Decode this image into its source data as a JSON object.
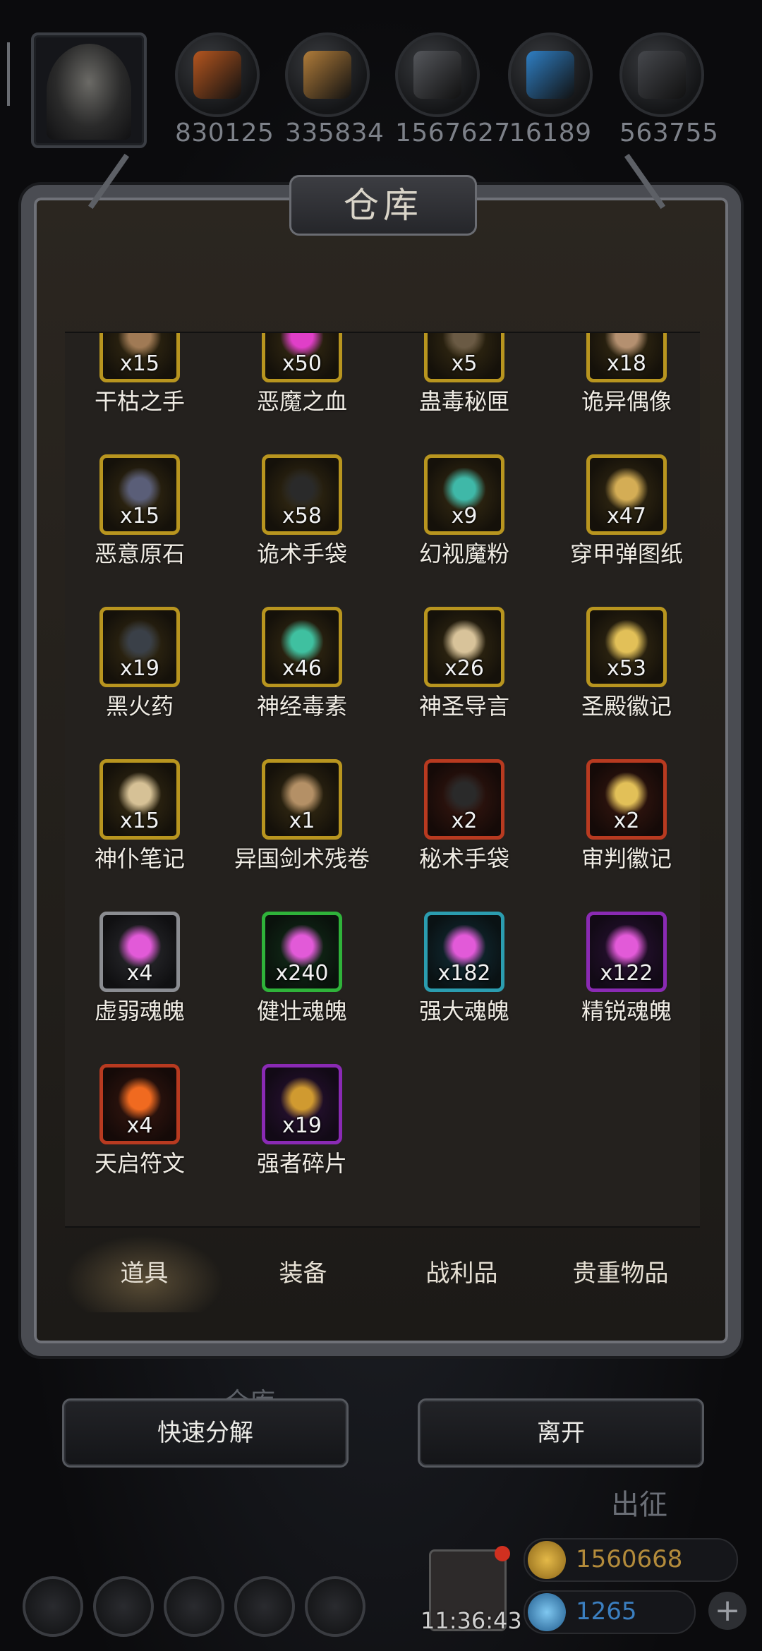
{
  "resources": [
    {
      "value": "830125",
      "icon": "meat-icon",
      "color": "#b5561f"
    },
    {
      "value": "335834",
      "icon": "wood-icon",
      "color": "#b07c3a"
    },
    {
      "value": "1567627",
      "icon": "iron-icon",
      "color": "#55575c"
    },
    {
      "value": "16189",
      "icon": "crystal-icon",
      "color": "#2f7fc4"
    },
    {
      "value": "563755",
      "icon": "ore-icon",
      "color": "#46484d"
    }
  ],
  "panel": {
    "title": "仓库"
  },
  "items": [
    {
      "name": "干枯之手",
      "qty": "x15",
      "rarity": "gold",
      "icon": "withered-hand-icon"
    },
    {
      "name": "恶魔之血",
      "qty": "x50",
      "rarity": "gold",
      "icon": "demon-blood-icon"
    },
    {
      "name": "蛊毒秘匣",
      "qty": "x5",
      "rarity": "gold",
      "icon": "poison-box-icon"
    },
    {
      "name": "诡异偶像",
      "qty": "x18",
      "rarity": "gold",
      "icon": "idol-icon"
    },
    {
      "name": "恶意原石",
      "qty": "x15",
      "rarity": "gold",
      "icon": "malice-stone-icon"
    },
    {
      "name": "诡术手袋",
      "qty": "x58",
      "rarity": "gold",
      "icon": "trick-bag-icon"
    },
    {
      "name": "幻视魔粉",
      "qty": "x9",
      "rarity": "gold",
      "icon": "magic-powder-icon"
    },
    {
      "name": "穿甲弹图纸",
      "qty": "x47",
      "rarity": "gold",
      "icon": "blueprint-icon"
    },
    {
      "name": "黑火药",
      "qty": "x19",
      "rarity": "gold",
      "icon": "black-powder-icon"
    },
    {
      "name": "神经毒素",
      "qty": "x46",
      "rarity": "gold",
      "icon": "neurotoxin-icon"
    },
    {
      "name": "神圣导言",
      "qty": "x26",
      "rarity": "gold",
      "icon": "holy-scroll-icon"
    },
    {
      "name": "圣殿徽记",
      "qty": "x53",
      "rarity": "gold",
      "icon": "temple-emblem-icon"
    },
    {
      "name": "神仆笔记",
      "qty": "x15",
      "rarity": "gold",
      "icon": "notes-icon"
    },
    {
      "name": "异国剑术残卷",
      "qty": "x1",
      "rarity": "gold",
      "icon": "sword-scroll-icon"
    },
    {
      "name": "秘术手袋",
      "qty": "x2",
      "rarity": "red",
      "icon": "arcane-bag-icon"
    },
    {
      "name": "审判徽记",
      "qty": "x2",
      "rarity": "red",
      "icon": "judgment-emblem-icon"
    },
    {
      "name": "虚弱魂魄",
      "qty": "x4",
      "rarity": "gray",
      "icon": "soul-icon"
    },
    {
      "name": "健壮魂魄",
      "qty": "x240",
      "rarity": "green",
      "icon": "soul-icon"
    },
    {
      "name": "强大魂魄",
      "qty": "x182",
      "rarity": "teal",
      "icon": "soul-icon"
    },
    {
      "name": "精锐魂魄",
      "qty": "x122",
      "rarity": "purple",
      "icon": "soul-icon"
    },
    {
      "name": "天启符文",
      "qty": "x4",
      "rarity": "red",
      "icon": "rune-icon"
    },
    {
      "name": "强者碎片",
      "qty": "x19",
      "rarity": "purple",
      "icon": "fragment-icon"
    }
  ],
  "tabs": [
    "道具",
    "装备",
    "战利品",
    "贵重物品"
  ],
  "buttons": {
    "decompose": "快速分解",
    "leave": "离开"
  },
  "background_labels": {
    "warehouse": "仓库",
    "expedition": "出征"
  },
  "clock": "11:36:43",
  "currency": {
    "gold": "1560668",
    "gems": "1265"
  }
}
